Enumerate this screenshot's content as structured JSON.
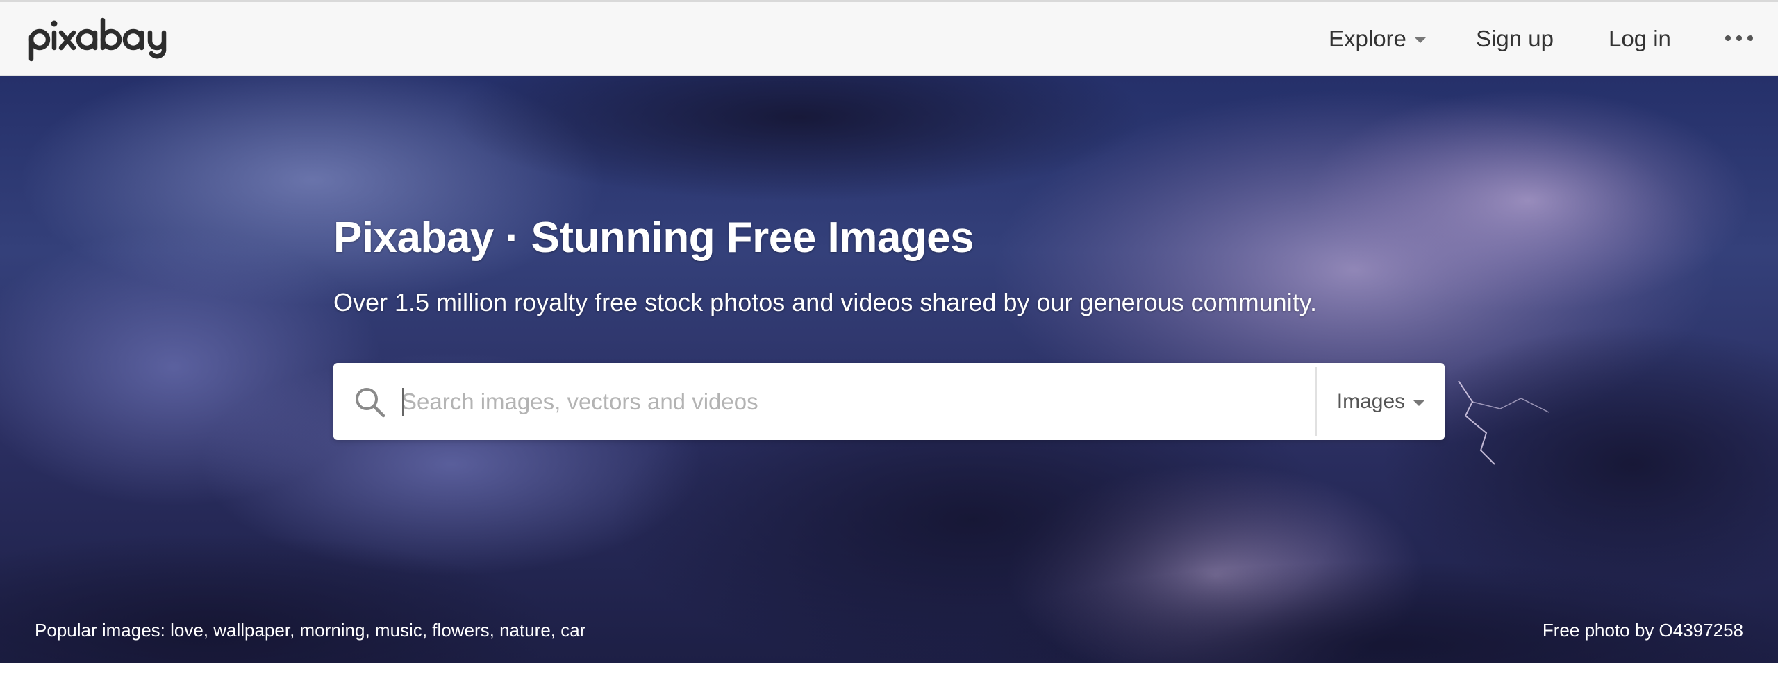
{
  "brand": {
    "logo_text": "pixabay"
  },
  "nav": {
    "explore": "Explore",
    "signup": "Sign up",
    "login": "Log in"
  },
  "hero": {
    "title": "Pixabay · Stunning Free Images",
    "subtitle": "Over 1.5 million royalty free stock photos and videos shared by our generous community.",
    "search": {
      "placeholder": "Search images, vectors and videos",
      "value": "",
      "type": "Images"
    },
    "popular": "Popular images: love, wallpaper, morning, music, flowers, nature, car",
    "credit": "Free photo by O4397258"
  },
  "icons": [
    "search-icon",
    "chevron-down-icon",
    "more-horizontal-icon"
  ],
  "colors": {
    "topbar_bg": "#f7f7f7",
    "hero_sky": "#2e3770",
    "text_dark": "#333333",
    "text_white": "#ffffff",
    "placeholder": "#b3b3b3"
  }
}
